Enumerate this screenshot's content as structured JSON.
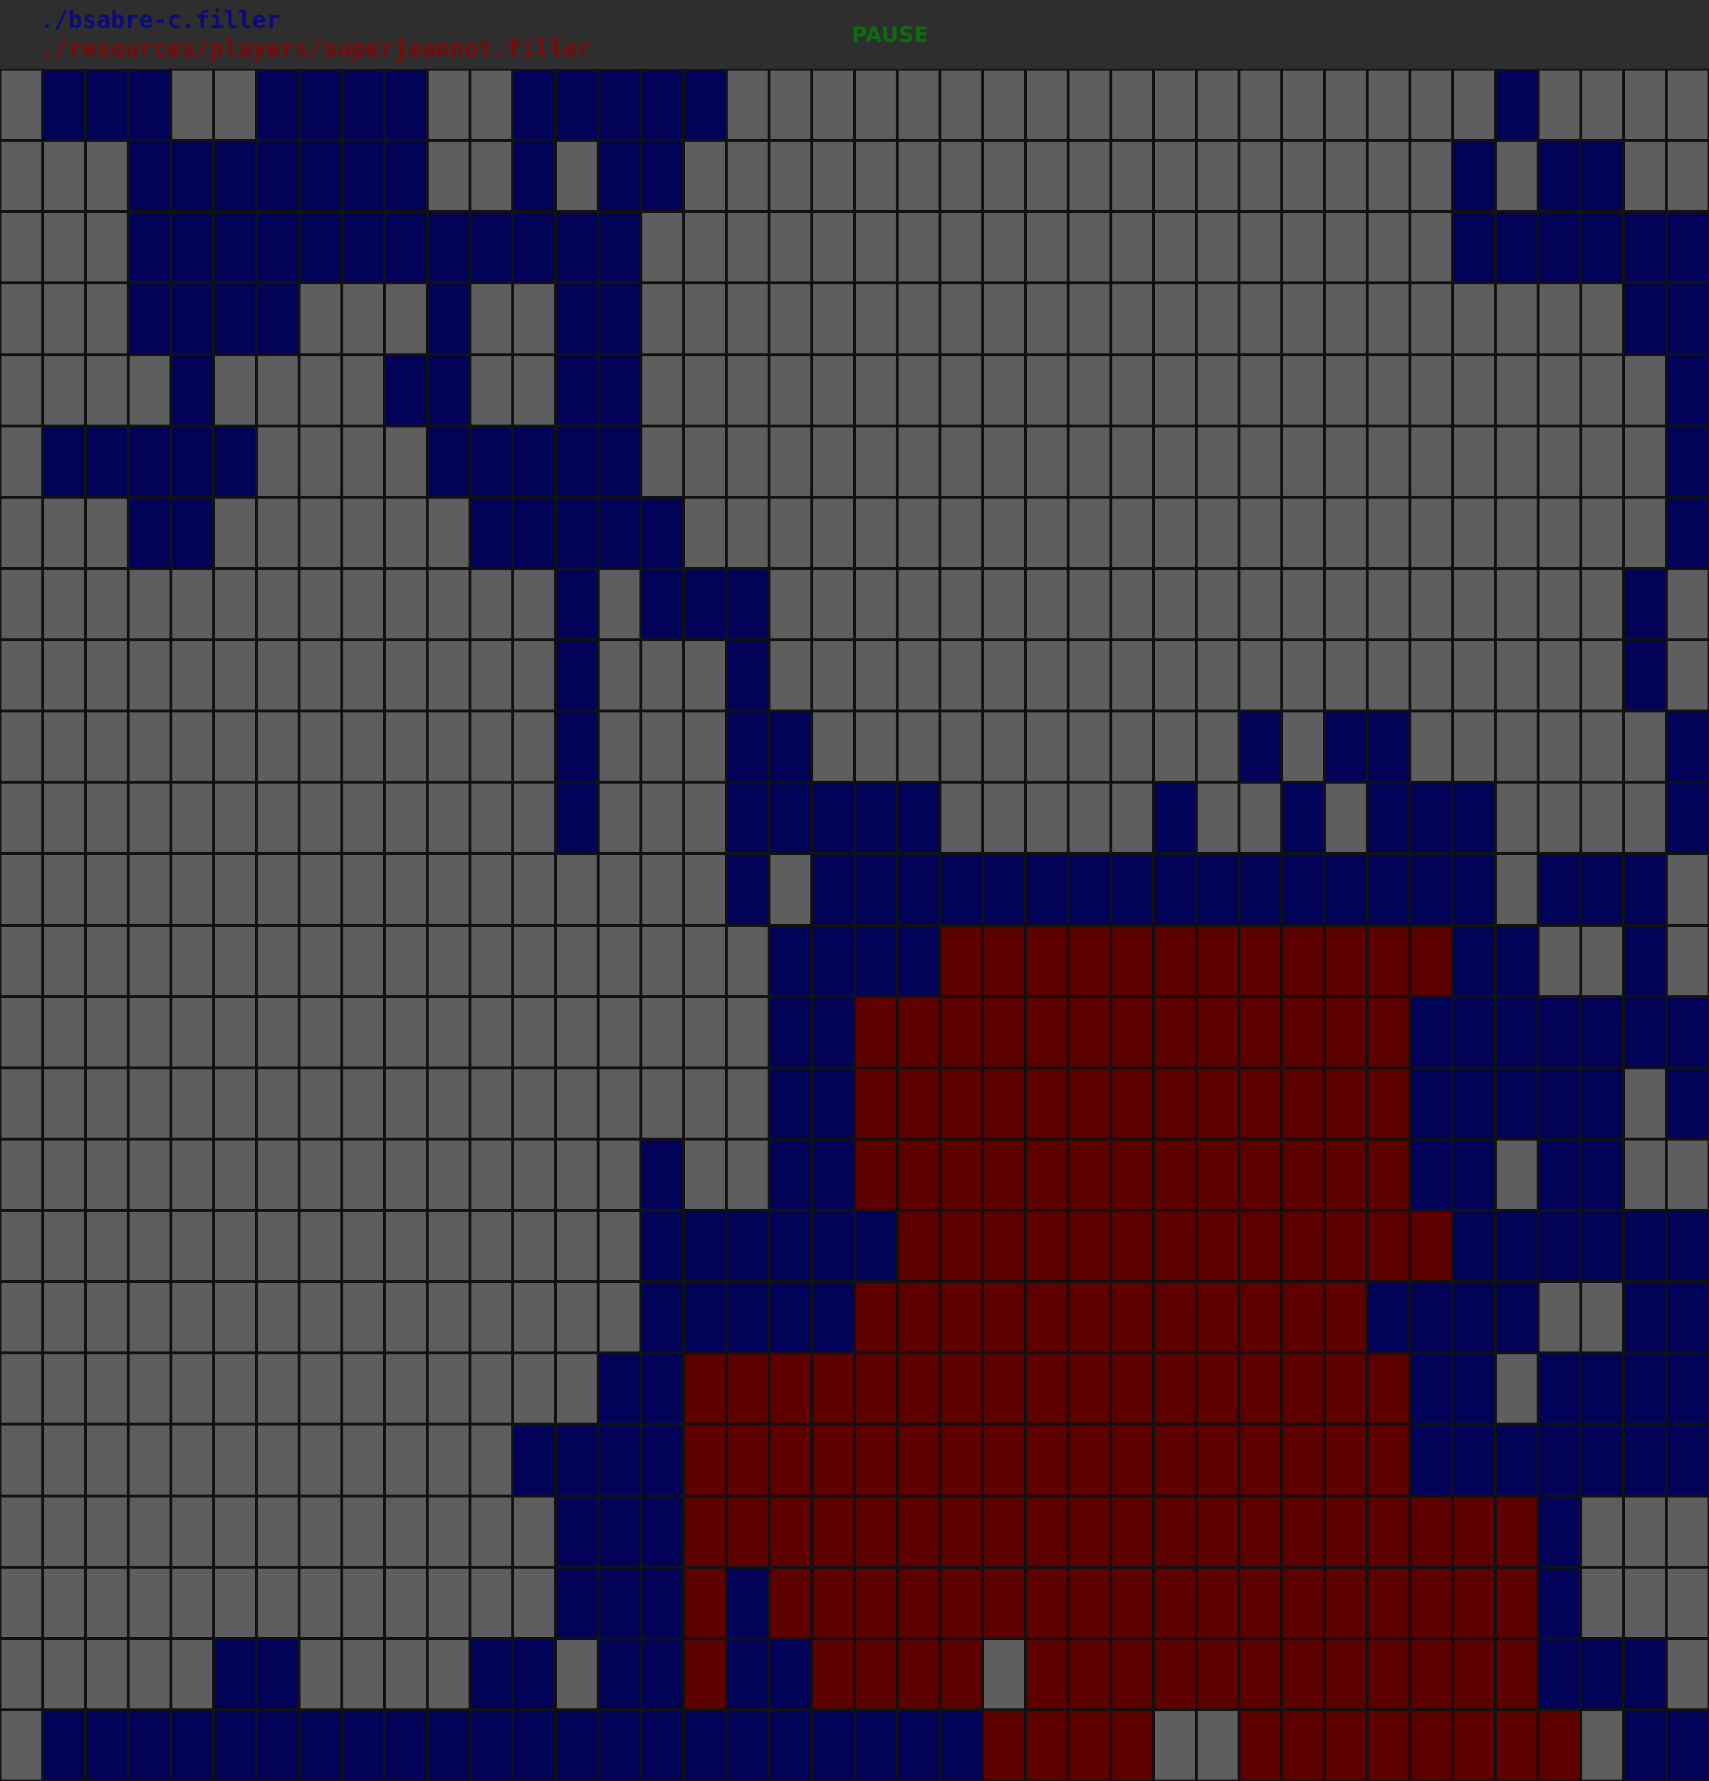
{
  "header": {
    "player1": "./bsabre-c.filler",
    "player2": "./resources/players/superjeannot.filler",
    "status": "PAUSE"
  },
  "colors": {
    "background": "#2e2e2e",
    "player1_text": "#0a0a7a",
    "player2_text": "#7a0a0a",
    "status_text": "#0f6b0f",
    "empty_cell": "#5e5e5e",
    "player1_cell": "#020259",
    "player2_cell": "#5e0000",
    "grid_line": "#111111"
  },
  "board": {
    "cols": 40,
    "rows": 24,
    "legend": {
      ".": "empty",
      "O": "player1",
      "X": "player2"
    },
    "cells": [
      ".OOO..OOOO..OOOOO..................O..",
      "...OOOOOOO..O.OO..................O.OO..",
      "...OOOOOOOOOOOO...................OOOOOO",
      "...OOOO...O..OO.......................OOO",
      "....O....OO..OO........................OO",
      ".OOOOO....OOOOO........................OO",
      "...OO......OOOOO.......................OO",
      ".............O.OOO....................O.O",
      ".............O...O....................O.O",
      ".............O...OO..........O.OO......O",
      ".............O...OOOOO.....O..O.OOO....OO",
      ".................O.OOOOOOOOOOOOOOOO.OOO.",
      "..................OOOOXXXXXXXXXXXXOO..O.",
      "..................OOXXXXXXXXXXXXXOOOOOOO",
      "..................OOXXXXXXXXXXXXXOOOOO.O",
      "...............O..OOXXXXXXXXXXXXXOO.OO..",
      "...............OOOOOOXXXXXXXXXXXXXOOOOOO",
      "...............OOOOOXXXXXXXXXXXXOOOO..OO",
      "..............OOXXXXXXXXXXXXXXXXXOO.OOOO",
      "............OOOOXXXXXXXXXXXXXXXXXOOOOOOO",
      ".............OOOXXXXXXXXXXXXXXXXXXXXO...",
      ".............OOOXOXXXXXXXXXXXXXXXXXXO...",
      ".....OO....OO.OOXOOXXXX.XXXXXXXXXXXXOOO",
      ".OOOOOOOOOOOOOOOOOOOOOOXXXX..XXXXXXXX.OO"
    ]
  }
}
